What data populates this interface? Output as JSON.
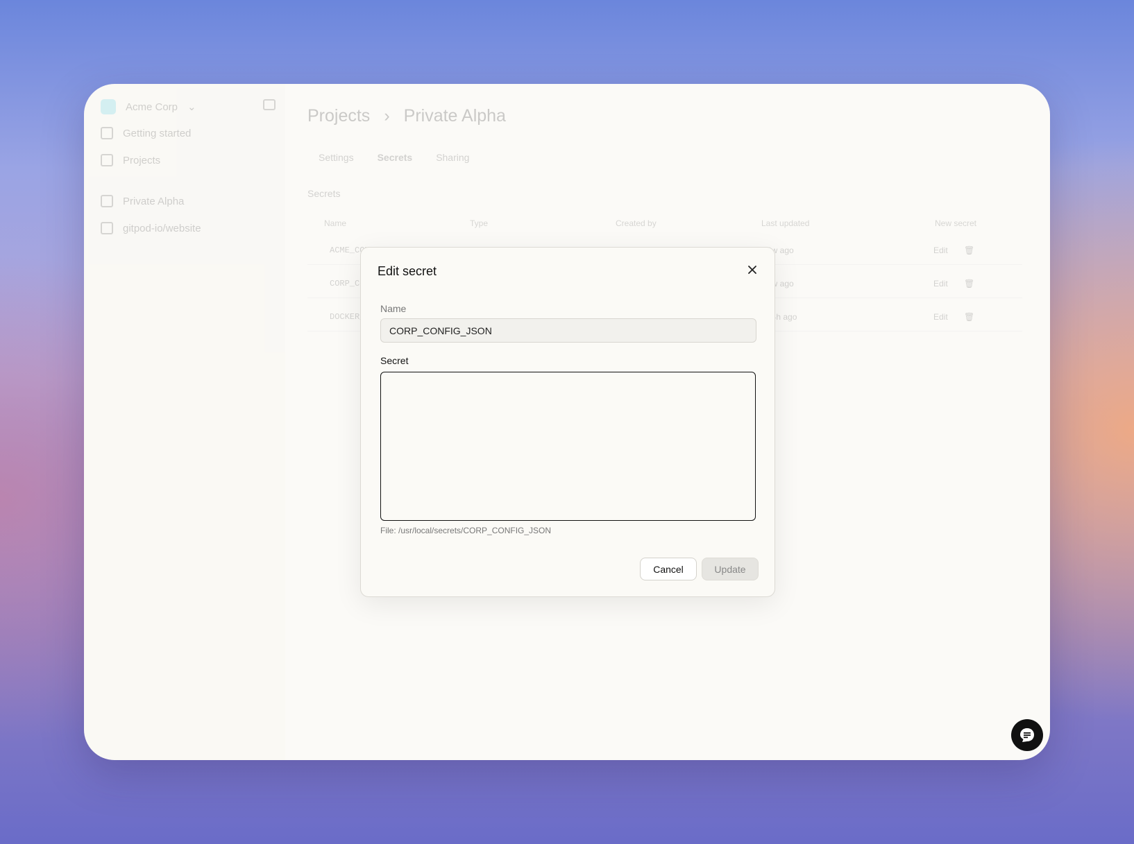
{
  "sidebar": {
    "org_name": "Acme Corp",
    "items": [
      {
        "label": "Getting started",
        "icon": "book-icon"
      },
      {
        "label": "Projects",
        "icon": "grid-icon"
      }
    ],
    "projects": [
      {
        "label": "Private Alpha",
        "icon": "box-icon"
      },
      {
        "label": "gitpod-io/website",
        "icon": "box-icon"
      }
    ]
  },
  "header": {
    "breadcrumb_root": "Projects",
    "breadcrumb_separator": "›",
    "breadcrumb_current": "Private Alpha"
  },
  "tabs": [
    "Settings",
    "Secrets",
    "Sharing"
  ],
  "secrets_section": {
    "title": "Secrets",
    "columns": [
      "Name",
      "Type",
      "Created by",
      "Last updated"
    ],
    "new_secret_label": "New secret",
    "rows": [
      {
        "name": "ACME_CONFIG_FILE",
        "updated": "2w ago",
        "edit": "Edit"
      },
      {
        "name": "CORP_CONFIG_JSON",
        "updated": "2w ago",
        "edit": "Edit"
      },
      {
        "name": "DOCKER_AUTH",
        "updated": "14h ago",
        "edit": "Edit"
      }
    ]
  },
  "modal": {
    "title": "Edit secret",
    "name_label": "Name",
    "name_value": "CORP_CONFIG_JSON",
    "secret_label": "Secret",
    "secret_value": "",
    "file_hint": "File: /usr/local/secrets/CORP_CONFIG_JSON",
    "cancel_label": "Cancel",
    "update_label": "Update"
  },
  "colors": {
    "org_logo": "#4cc9e0",
    "chat_button": "#111111"
  }
}
